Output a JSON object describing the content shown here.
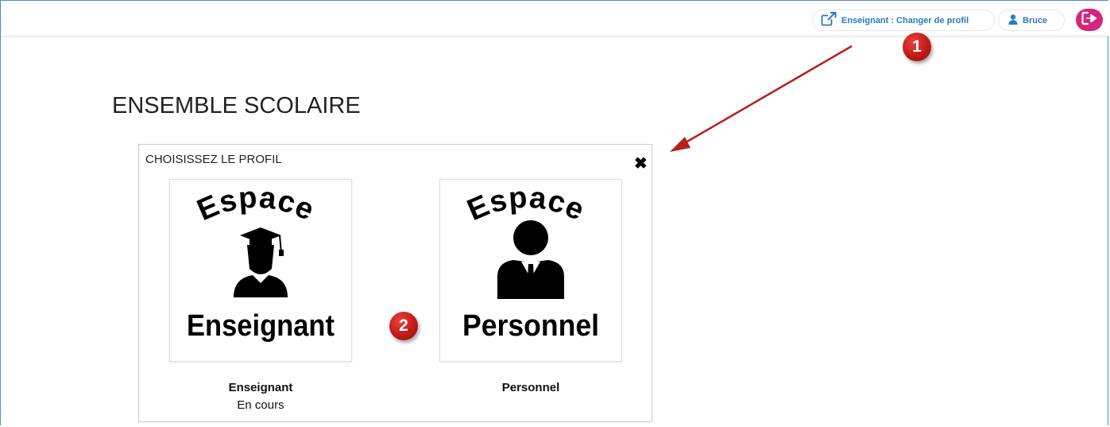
{
  "header": {
    "profile_switch_label": "Enseignant : Changer de profil",
    "user_name": "Bruce",
    "accent_color": "#2a7bbf",
    "logout_color": "#d4267a",
    "icons": [
      "external-link-icon",
      "user-icon",
      "logout-icon"
    ]
  },
  "annotations": {
    "marker_1": "1",
    "marker_2": "2",
    "marker_color": "#c11b17"
  },
  "page": {
    "title": "ENSEMBLE SCOLAIRE"
  },
  "modal": {
    "title": "CHOISISSEZ LE PROFIL",
    "close_symbol": "✖",
    "profiles": [
      {
        "name": "Enseignant",
        "status": "En cours",
        "image_top": "Espace",
        "image_bottom": "Enseignant"
      },
      {
        "name": "Personnel",
        "status": "",
        "image_top": "Espace",
        "image_bottom": "Personnel"
      }
    ]
  }
}
